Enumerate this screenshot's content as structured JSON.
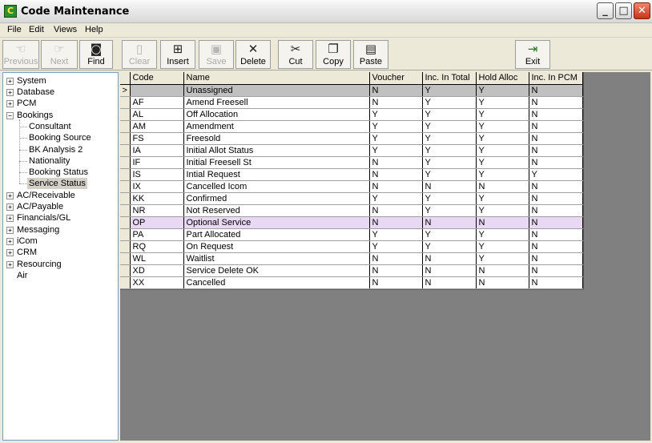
{
  "window": {
    "title": "Code Maintenance",
    "icon": "app-icon"
  },
  "menu": [
    "File",
    "Edit",
    "Views",
    "Help"
  ],
  "toolbar": {
    "previous": "Previous",
    "next": "Next",
    "find": "Find",
    "clear": "Clear",
    "insert": "Insert",
    "save": "Save",
    "delete": "Delete",
    "cut": "Cut",
    "copy": "Copy",
    "paste": "Paste",
    "exit": "Exit"
  },
  "tree": {
    "system": "System",
    "database": "Database",
    "pcm": "PCM",
    "bookings": "Bookings",
    "bookings_children": [
      "Consultant",
      "Booking Source",
      "BK Analysis 2",
      "Nationality",
      "Booking Status",
      "Service Status"
    ],
    "ac_receivable": "AC/Receivable",
    "ac_payable": "AC/Payable",
    "financials": "Financials/GL",
    "messaging": "Messaging",
    "icom": "iCom",
    "crm": "CRM",
    "resourcing": "Resourcing",
    "air": "Air"
  },
  "grid": {
    "columns": [
      "Code",
      "Name",
      "Voucher",
      "Inc. In Total",
      "Hold Alloc",
      "Inc. In PCM"
    ],
    "current_indicator": ">",
    "rows": [
      {
        "code": "",
        "name": "Unassigned",
        "voucher": "N",
        "inc_total": "Y",
        "hold_alloc": "Y",
        "inc_pcm": "N"
      },
      {
        "code": "AF",
        "name": "Amend Freesell",
        "voucher": "N",
        "inc_total": "Y",
        "hold_alloc": "Y",
        "inc_pcm": "N"
      },
      {
        "code": "AL",
        "name": "Off Allocation",
        "voucher": "Y",
        "inc_total": "Y",
        "hold_alloc": "Y",
        "inc_pcm": "N"
      },
      {
        "code": "AM",
        "name": "Amendment",
        "voucher": "Y",
        "inc_total": "Y",
        "hold_alloc": "Y",
        "inc_pcm": "N"
      },
      {
        "code": "FS",
        "name": "Freesold",
        "voucher": "Y",
        "inc_total": "Y",
        "hold_alloc": "Y",
        "inc_pcm": "N"
      },
      {
        "code": "IA",
        "name": "Initial Allot Status",
        "voucher": "Y",
        "inc_total": "Y",
        "hold_alloc": "Y",
        "inc_pcm": "N"
      },
      {
        "code": "IF",
        "name": "Initial Freesell St",
        "voucher": "N",
        "inc_total": "Y",
        "hold_alloc": "Y",
        "inc_pcm": "N"
      },
      {
        "code": "IS",
        "name": "Intial Request",
        "voucher": "N",
        "inc_total": "Y",
        "hold_alloc": "Y",
        "inc_pcm": "Y"
      },
      {
        "code": "IX",
        "name": "Cancelled Icom",
        "voucher": "N",
        "inc_total": "N",
        "hold_alloc": "N",
        "inc_pcm": "N"
      },
      {
        "code": "KK",
        "name": "Confirmed",
        "voucher": "Y",
        "inc_total": "Y",
        "hold_alloc": "Y",
        "inc_pcm": "N"
      },
      {
        "code": "NR",
        "name": "Not Reserved",
        "voucher": "N",
        "inc_total": "Y",
        "hold_alloc": "Y",
        "inc_pcm": "N"
      },
      {
        "code": "OP",
        "name": "Optional Service",
        "voucher": "N",
        "inc_total": "N",
        "hold_alloc": "N",
        "inc_pcm": "N"
      },
      {
        "code": "PA",
        "name": "Part Allocated",
        "voucher": "Y",
        "inc_total": "Y",
        "hold_alloc": "Y",
        "inc_pcm": "N"
      },
      {
        "code": "RQ",
        "name": "On Request",
        "voucher": "Y",
        "inc_total": "Y",
        "hold_alloc": "Y",
        "inc_pcm": "N"
      },
      {
        "code": "WL",
        "name": "Waitlist",
        "voucher": "N",
        "inc_total": "N",
        "hold_alloc": "Y",
        "inc_pcm": "N"
      },
      {
        "code": "XD",
        "name": "Service Delete OK",
        "voucher": "N",
        "inc_total": "N",
        "hold_alloc": "N",
        "inc_pcm": "N"
      },
      {
        "code": "XX",
        "name": "Cancelled",
        "voucher": "N",
        "inc_total": "N",
        "hold_alloc": "N",
        "inc_pcm": "N"
      }
    ]
  },
  "colors": {
    "highlight_row": "#e8d8f4",
    "current_row": "#c0c0c0",
    "grid_background": "#808080"
  }
}
